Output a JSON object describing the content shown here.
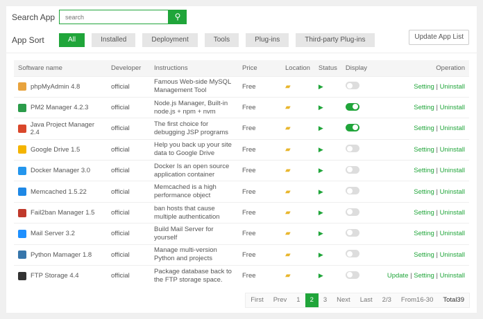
{
  "search": {
    "label": "Search App",
    "placeholder": "search"
  },
  "sort": {
    "label": "App Sort",
    "items": [
      "All",
      "Installed",
      "Deployment",
      "Tools",
      "Plug-ins",
      "Third-party Plug-ins"
    ],
    "active": "All"
  },
  "update_button": "Update App List",
  "table": {
    "headers": [
      "Software name",
      "Developer",
      "Instructions",
      "Price",
      "Location",
      "Status",
      "Display",
      "Operation"
    ],
    "rows": [
      {
        "name": "phpMyAdmin 4.8",
        "icon": "phpmyadmin-icon",
        "color": "#e8a33d",
        "developer": "official",
        "instructions": "Famous Web-side MySQL Management Tool",
        "price": "Free",
        "display": false,
        "ops": [
          "Setting",
          "Uninstall"
        ]
      },
      {
        "name": "PM2 Manager 4.2.3",
        "icon": "pm2-icon",
        "color": "#2b9c4a",
        "developer": "official",
        "instructions": "Node.js Manager, Built-in node.js + npm + nvm",
        "price": "Free",
        "display": true,
        "ops": [
          "Setting",
          "Uninstall"
        ]
      },
      {
        "name": "Java Project Manager 2.4",
        "icon": "java-icon",
        "color": "#d9472b",
        "developer": "official",
        "instructions": "The first choice for debugging JSP programs",
        "price": "Free",
        "display": true,
        "ops": [
          "Setting",
          "Uninstall"
        ]
      },
      {
        "name": "Google Drive 1.5",
        "icon": "google-drive-icon",
        "color": "#f4b400",
        "developer": "official",
        "instructions": "Help you back up your site data to Google Drive",
        "price": "Free",
        "display": false,
        "ops": [
          "Setting",
          "Uninstall"
        ]
      },
      {
        "name": "Docker Manager 3.0",
        "icon": "docker-icon",
        "color": "#2496ed",
        "developer": "official",
        "instructions": "Docker Is an open source application container",
        "price": "Free",
        "display": false,
        "ops": [
          "Setting",
          "Uninstall"
        ]
      },
      {
        "name": "Memcached 1.5.22",
        "icon": "memcached-icon",
        "color": "#1e88e5",
        "developer": "official",
        "instructions": "Memcached is a high performance object",
        "price": "Free",
        "display": false,
        "ops": [
          "Setting",
          "Uninstall"
        ]
      },
      {
        "name": "Fail2ban Manager 1.5",
        "icon": "fail2ban-icon",
        "color": "#c0392b",
        "developer": "official",
        "instructions": "ban hosts that cause multiple authentication",
        "price": "Free",
        "display": false,
        "ops": [
          "Setting",
          "Uninstall"
        ]
      },
      {
        "name": "Mail Server 3.2",
        "icon": "mail-icon",
        "color": "#1e90ff",
        "developer": "official",
        "instructions": "Build Mail Server for yourself",
        "price": "Free",
        "display": false,
        "ops": [
          "Setting",
          "Uninstall"
        ]
      },
      {
        "name": "Python Mamager 1.8",
        "icon": "python-icon",
        "color": "#3776ab",
        "developer": "official",
        "instructions": "Manage multi-version Python and projects",
        "price": "Free",
        "display": false,
        "ops": [
          "Setting",
          "Uninstall"
        ]
      },
      {
        "name": "FTP Storage 4.4",
        "icon": "ftp-icon",
        "color": "#333333",
        "developer": "official",
        "instructions": "Package database back to the FTP storage space.",
        "price": "Free",
        "display": false,
        "ops": [
          "Update",
          "Setting",
          "Uninstall"
        ]
      }
    ]
  },
  "pager": {
    "items": [
      "First",
      "Prev",
      "1",
      "2",
      "3",
      "Next",
      "Last",
      "2/3",
      "From16-30",
      "Total39"
    ],
    "current": "2"
  },
  "colors": {
    "accent": "#20a53a",
    "folder": "#e8b62d"
  }
}
